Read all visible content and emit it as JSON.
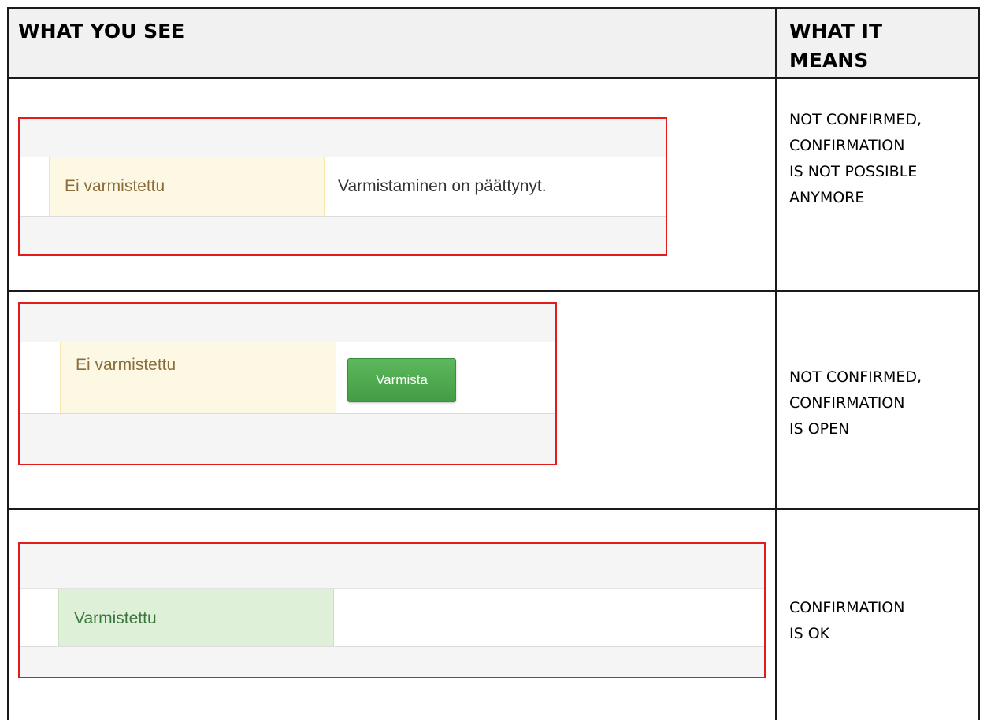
{
  "table": {
    "headers": {
      "what_you_see": "WHAT YOU SEE",
      "what_it_means": "WHAT IT\nMEANS"
    },
    "rows": [
      {
        "status_label": "Ei varmistettu",
        "info_text": "Varmistaminen on päättynyt.",
        "meaning": "NOT CONFIRMED,\nCONFIRMATION\nIS NOT POSSIBLE\nANYMORE"
      },
      {
        "status_label": "Ei varmistettu",
        "button_label": "Varmista",
        "meaning": "NOT CONFIRMED,\nCONFIRMATION\nIS OPEN"
      },
      {
        "status_label": "Varmistettu",
        "meaning": "CONFIRMATION\nIS OK"
      }
    ]
  },
  "colors": {
    "highlight_border": "#e31b1b",
    "warning_bg": "#fcf8e3",
    "warning_text": "#8a6d3b",
    "success_bg": "#dff0d8",
    "success_text": "#3c763d",
    "button_green": "#5cb85c"
  }
}
